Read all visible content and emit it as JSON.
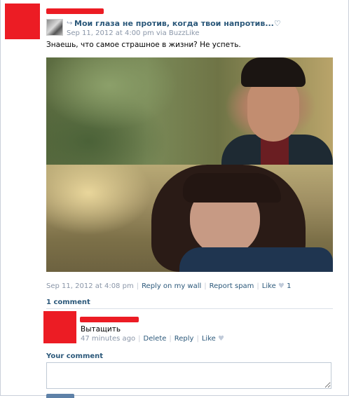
{
  "post": {
    "source_title": "Мои глаза не против, когда твои напротив...",
    "source_heart": "♡",
    "source_date": "Sep 11, 2012 at 4:00 pm via BuzzLike",
    "text": "Знаешь, что самое страшное в жизни? Не успеть.",
    "meta": {
      "date": "Sep 11, 2012 at 4:08 pm",
      "reply_link": "Reply on my wall",
      "report_link": "Report spam",
      "like_link": "Like",
      "like_icon": "♥",
      "like_count": "1"
    }
  },
  "comments": {
    "count_label": "1 comment",
    "items": [
      {
        "text": "Вытащить",
        "time": "47 minutes ago",
        "delete_label": "Delete",
        "reply_label": "Reply",
        "like_label": "Like",
        "like_icon": "♥"
      }
    ]
  },
  "your_comment": {
    "label": "Your comment",
    "placeholder": ""
  },
  "colors": {
    "link": "#2b587a",
    "redaction": "#ec1c24",
    "meta_gray": "#8a96a8"
  }
}
